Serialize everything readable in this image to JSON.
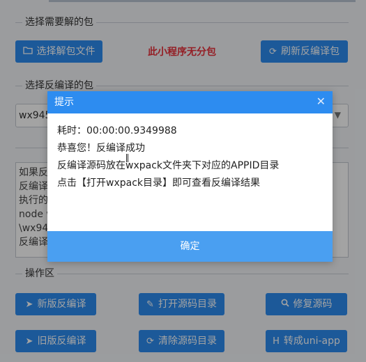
{
  "sections": {
    "select_package": "选择需要解的包",
    "select_decompile": "选择反编译的包",
    "operations": "操作区"
  },
  "toolbar": {
    "choose_file": "选择解包文件",
    "notice": "此小程序无分包",
    "refresh": "刷新反编译包"
  },
  "package_select": {
    "value": "wx945"
  },
  "log_lines": [
    "如果反",
    "反编译",
    "执行的",
    "node w",
    "\\wx94",
    "反编译"
  ],
  "actions": {
    "new_decompile": "新版反编译",
    "open_source_dir": "打开源码目录",
    "fix_source": "修复源码",
    "old_decompile": "旧版反编译",
    "clear_source_dir": "清除源码目录",
    "to_uniapp": "转成uni-app"
  },
  "dialog": {
    "title": "提示",
    "lines": [
      "耗时：00:00:00.9349988",
      "恭喜您！反编译成功",
      "反编译源码放在wxpack文件夹下对应的APPID目录",
      "点击【打开wxpack目录】即可查看反编译结果"
    ],
    "ok_label": "确定"
  },
  "colors": {
    "primary": "#2d8cf0",
    "notice_red": "#e8303a",
    "dialog_ok": "#4a9ff1"
  },
  "icons": {
    "choose_file": "folder-icon",
    "refresh": "refresh-icon",
    "new_decompile": "navigation-arrow-icon",
    "open_source_dir": "brush-icon",
    "fix_source": "search-icon",
    "old_decompile": "navigation-arrow-icon",
    "clear_source_dir": "refresh-icon",
    "to_uniapp": "h-letter-icon"
  }
}
